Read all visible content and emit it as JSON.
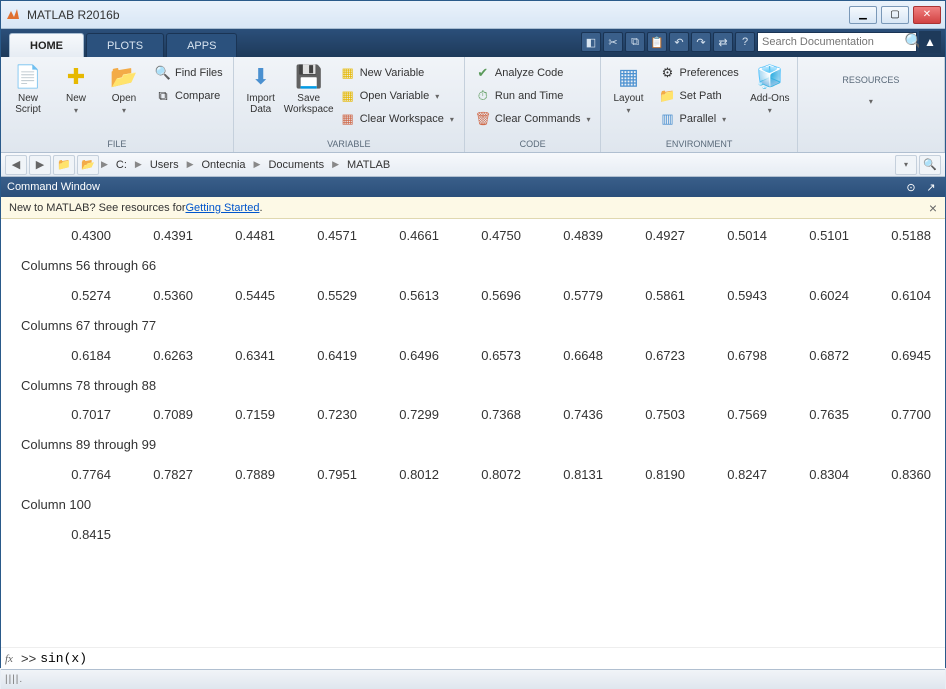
{
  "titlebar": {
    "title": "MATLAB R2016b"
  },
  "tabs": {
    "home": "HOME",
    "plots": "PLOTS",
    "apps": "APPS"
  },
  "search": {
    "placeholder": "Search Documentation"
  },
  "ribbon": {
    "file": {
      "label": "FILE",
      "new_script": "New\nScript",
      "new": "New",
      "open": "Open",
      "find_files": "Find Files",
      "compare": "Compare"
    },
    "variable": {
      "label": "VARIABLE",
      "import_data": "Import\nData",
      "save_workspace": "Save\nWorkspace",
      "new_variable": "New Variable",
      "open_variable": "Open Variable",
      "clear_workspace": "Clear Workspace"
    },
    "code": {
      "label": "CODE",
      "analyze": "Analyze Code",
      "run_time": "Run and Time",
      "clear_cmd": "Clear Commands"
    },
    "environment": {
      "label": "ENVIRONMENT",
      "layout": "Layout",
      "prefs": "Preferences",
      "set_path": "Set Path",
      "parallel": "Parallel",
      "addons": "Add-Ons"
    },
    "resources": {
      "label": "RESOURCES"
    }
  },
  "path": {
    "segs": [
      "C:",
      "Users",
      "Ontecnia",
      "Documents",
      "MATLAB"
    ]
  },
  "cmdwin": {
    "title": "Command Window",
    "banner_pre": "New to MATLAB? See resources for ",
    "banner_link": "Getting Started",
    "banner_post": "."
  },
  "output": {
    "rows": [
      {
        "header": null,
        "vals": [
          "0.4300",
          "0.4391",
          "0.4481",
          "0.4571",
          "0.4661",
          "0.4750",
          "0.4839",
          "0.4927",
          "0.5014",
          "0.5101",
          "0.5188"
        ]
      },
      {
        "header": "Columns 56 through 66",
        "vals": [
          "0.5274",
          "0.5360",
          "0.5445",
          "0.5529",
          "0.5613",
          "0.5696",
          "0.5779",
          "0.5861",
          "0.5943",
          "0.6024",
          "0.6104"
        ]
      },
      {
        "header": "Columns 67 through 77",
        "vals": [
          "0.6184",
          "0.6263",
          "0.6341",
          "0.6419",
          "0.6496",
          "0.6573",
          "0.6648",
          "0.6723",
          "0.6798",
          "0.6872",
          "0.6945"
        ]
      },
      {
        "header": "Columns 78 through 88",
        "vals": [
          "0.7017",
          "0.7089",
          "0.7159",
          "0.7230",
          "0.7299",
          "0.7368",
          "0.7436",
          "0.7503",
          "0.7569",
          "0.7635",
          "0.7700"
        ]
      },
      {
        "header": "Columns 89 through 99",
        "vals": [
          "0.7764",
          "0.7827",
          "0.7889",
          "0.7951",
          "0.8012",
          "0.8072",
          "0.8131",
          "0.8190",
          "0.8247",
          "0.8304",
          "0.8360"
        ]
      },
      {
        "header": "Column 100",
        "vals": [
          "0.8415"
        ]
      }
    ]
  },
  "prompt": {
    "prefix": ">> ",
    "value": "sin(x)"
  },
  "status": {
    "text": "||||."
  }
}
